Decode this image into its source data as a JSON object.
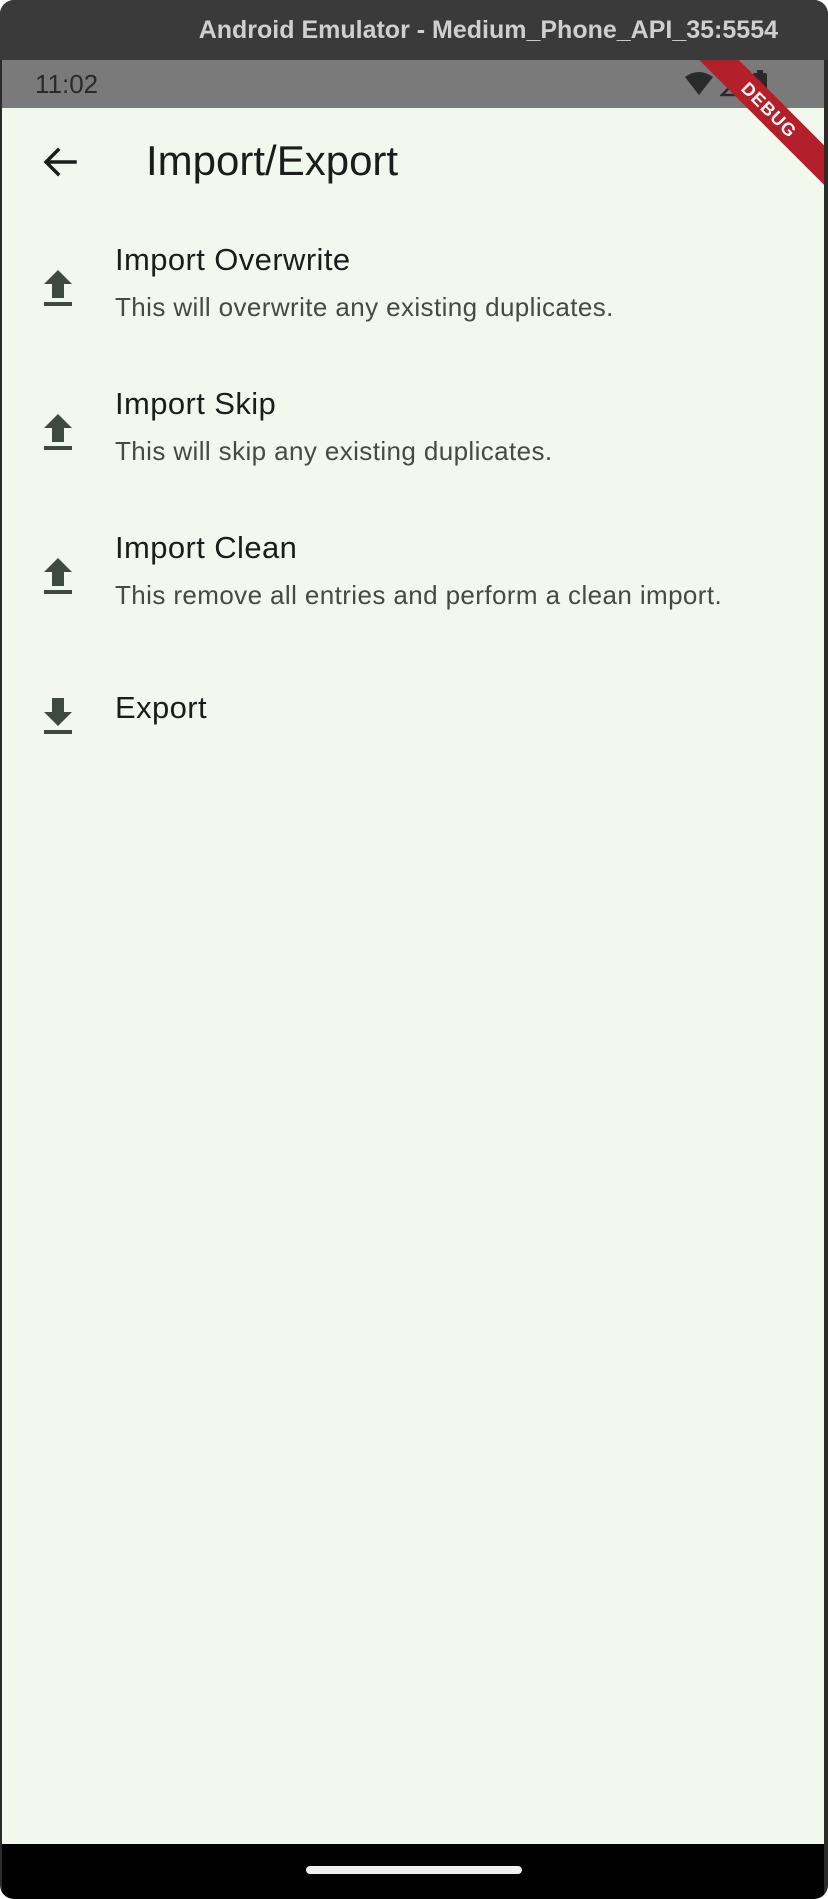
{
  "window": {
    "title": "Android Emulator - Medium_Phone_API_35:5554"
  },
  "status_bar": {
    "time": "11:02",
    "icons": [
      "wifi-icon",
      "signal-icon",
      "battery-icon"
    ]
  },
  "debug_banner": {
    "label": "DEBUG",
    "color": "#b3202a"
  },
  "app_bar": {
    "back_icon": "arrow-back-icon",
    "title": "Import/Export"
  },
  "items": [
    {
      "icon": "upload-icon",
      "title": "Import Overwrite",
      "subtitle": "This will overwrite any existing duplicates."
    },
    {
      "icon": "upload-icon",
      "title": "Import Skip",
      "subtitle": "This will skip any existing duplicates."
    },
    {
      "icon": "upload-icon",
      "title": "Import Clean",
      "subtitle": "This remove all entries and perform a clean import."
    },
    {
      "icon": "download-icon",
      "title": "Export"
    }
  ],
  "colors": {
    "background": "#f3f8ef",
    "icon": "#3f4a3f",
    "text": "#1c1c1c"
  }
}
